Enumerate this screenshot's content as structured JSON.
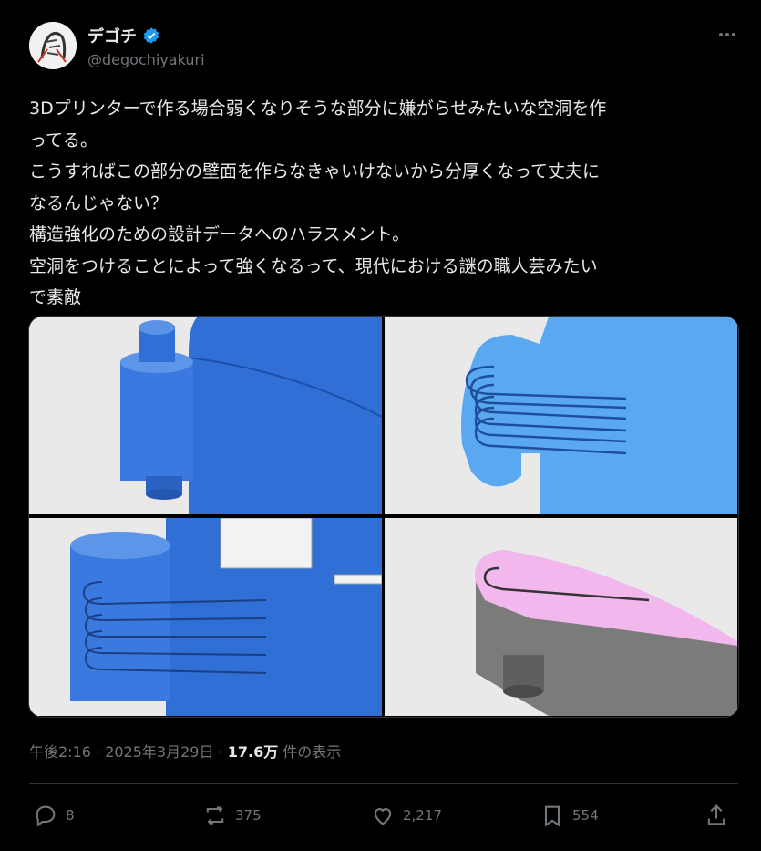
{
  "author": {
    "name": "デゴチ",
    "handle": "@degochiyakuri",
    "verified": true
  },
  "tweet": {
    "lines": [
      "3Dプリンターで作る場合弱くなりそうな部分に嫌がらせみたいな空洞を作",
      "ってる。",
      "こうすればこの部分の壁面を作らなきゃいけないから分厚くなって丈夫に",
      "なるんじゃない？",
      "構造強化のための設計データへのハラスメント。",
      "空洞をつけることによって強くなるって、現代における謎の職人芸みたい",
      "で素敵"
    ]
  },
  "meta": {
    "time": "午後2:16 · 2025年3月29日 · ",
    "views": "17.6万",
    "views_suffix": " 件の表示"
  },
  "actions": {
    "replies": "8",
    "reposts": "375",
    "likes": "2,217",
    "bookmarks": "554"
  },
  "colors": {
    "cad_blue": "#2f6fd6",
    "cad_light_blue": "#5aa8f0",
    "pink": "#f2b8ee",
    "gray": "#7b7b7b",
    "verified": "#1d9bf0"
  }
}
